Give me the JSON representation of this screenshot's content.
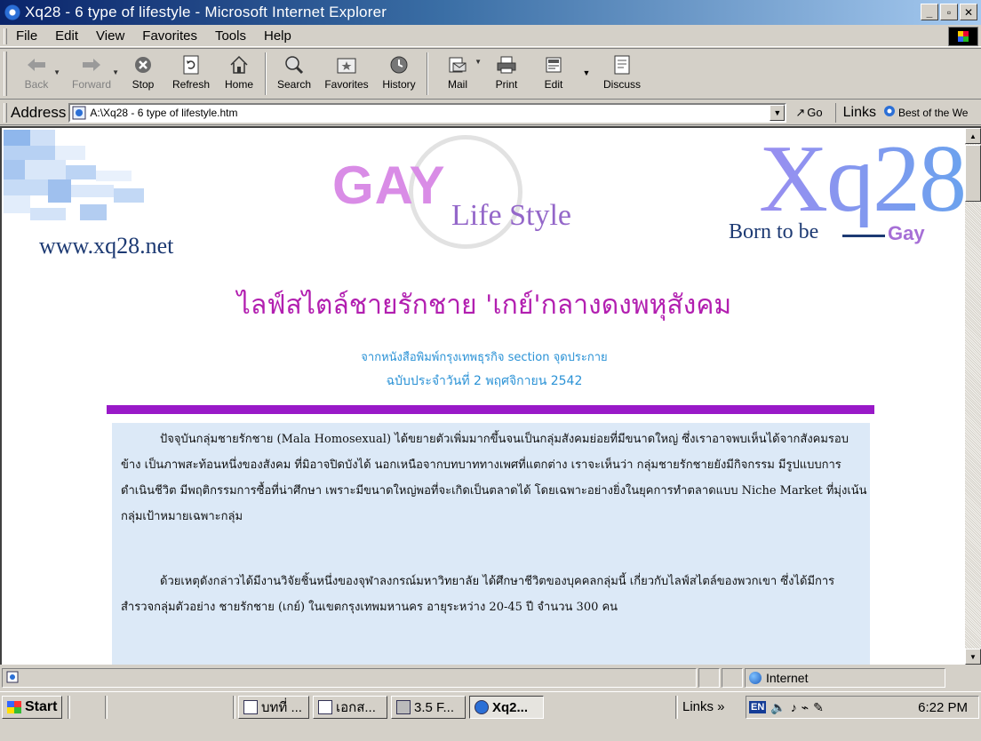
{
  "window": {
    "title": "Xq28 - 6 type of lifestyle - Microsoft Internet Explorer",
    "min_glyph": "_",
    "max_glyph": "▫",
    "close_glyph": "✕"
  },
  "menu": {
    "file": "File",
    "edit": "Edit",
    "view": "View",
    "favorites": "Favorites",
    "tools": "Tools",
    "help": "Help"
  },
  "toolbar": {
    "back": "Back",
    "forward": "Forward",
    "stop": "Stop",
    "refresh": "Refresh",
    "home": "Home",
    "search": "Search",
    "favorites": "Favorites",
    "history": "History",
    "mail": "Mail",
    "print": "Print",
    "edit": "Edit",
    "discuss": "Discuss"
  },
  "address": {
    "label": "Address",
    "url": "A:\\Xq28 - 6 type of lifestyle.htm",
    "go": "Go",
    "links_label": "Links",
    "links_first": "Best of the We"
  },
  "page": {
    "site_url": "www.xq28.net",
    "logo_gay": "GAY",
    "logo_lifestyle": "Life Style",
    "logo_xq28": "Xq28",
    "logo_born": "Born to be",
    "logo_gay_small": "Gay",
    "headline": "ไลฟ์สไตล์ชายรักชาย 'เกย์'กลางดงพหุสังคม",
    "source_line1": "จากหนังสือพิมพ์กรุงเทพธุรกิจ section จุดประกาย",
    "source_line2": "ฉบับประจำวันที่ 2 พฤศจิกายน 2542",
    "paragraph1": "ปัจจุบันกลุ่มชายรักชาย (Mala Homosexual) ได้ขยายตัวเพิ่มมากขึ้นจนเป็นกลุ่มสังคมย่อยที่มีขนาดใหญ่ ซึ่งเราอาจพบเห็นได้จากสังคมรอบข้าง เป็นภาพสะท้อนหนึ่งของสังคม ที่มิอาจปิดบังได้ นอกเหนือจากบทบาททางเพศที่แตกต่าง เราจะเห็นว่า กลุ่มชายรักชายยังมีกิจกรรม มีรูปแบบการดำเนินชีวิต มีพฤติกรรมการซื้อที่น่าศึกษา เพราะมีขนาดใหญ่พอที่จะเกิดเป็นตลาดได้ โดยเฉพาะอย่างยิ่งในยุคการทำตลาดแบบ Niche Market ที่มุ่งเน้นกลุ่มเป้าหมายเฉพาะกลุ่ม",
    "paragraph2": "ด้วยเหตุดังกล่าวได้มีงานวิจัยชิ้นหนึ่งของจุฬาลงกรณ์มหาวิทยาลัย ได้ศึกษาชีวิตของบุคคลกลุ่มนี้ เกี่ยวกับไลฟ์สไตล์ของพวกเขา ซึ่งได้มีการสำรวจกลุ่มตัวอย่าง ชายรักชาย (เกย์) ในเขตกรุงเทพมหานคร อายุระหว่าง 20-45 ปี จำนวน 300 คน"
  },
  "status": {
    "zone": "Internet"
  },
  "taskbar": {
    "start": "Start",
    "tasks": [
      "บทที่ ...",
      "เอกส...",
      "3.5 F...",
      "Xq2..."
    ],
    "links": "Links »",
    "lang": "EN",
    "clock": "6:22 PM"
  },
  "colors": {
    "headline": "#b21fb0",
    "source": "#2a92d6",
    "divider": "#9919c8",
    "article_bg": "#dce9f7",
    "title_gradient_start": "#0a246a"
  }
}
